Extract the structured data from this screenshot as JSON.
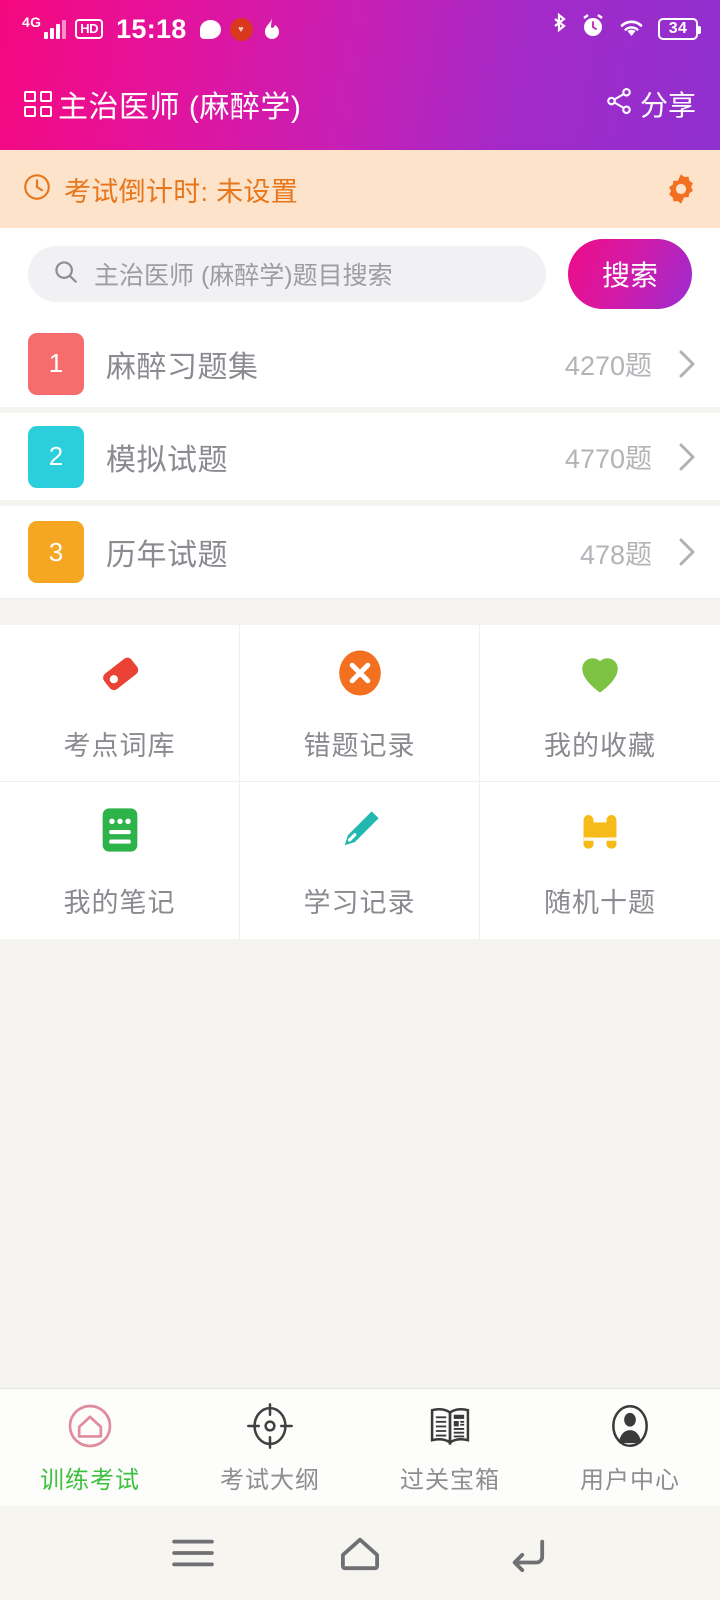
{
  "status_bar": {
    "network_type": "4G",
    "hd_label": "HD",
    "time": "15:18",
    "battery_level": "34",
    "icons": [
      "signal-bars-icon",
      "hd-icon",
      "chat-bubble-icon",
      "red-heart-badge-icon",
      "flame-icon",
      "bluetooth-icon",
      "alarm-icon",
      "wifi-icon",
      "battery-icon"
    ]
  },
  "header": {
    "title": "主治医师 (麻醉学)",
    "grid_icon": "apps-grid-icon",
    "share_label": "分享",
    "share_icon": "share-icon",
    "gradient_from": "#f5087f",
    "gradient_to": "#8f30cf"
  },
  "countdown": {
    "clock_icon": "clock-icon",
    "text": "考试倒计时: 未设置",
    "gear_icon": "gear-icon",
    "background": "#fde3ca",
    "text_color": "#e8761b"
  },
  "search": {
    "placeholder": "主治医师 (麻醉学)题目搜索",
    "value": "",
    "search_icon": "search-icon",
    "button_label": "搜索"
  },
  "question_banks": [
    {
      "index": "1",
      "label": "麻醉习题集",
      "count": "4270题",
      "color": "#f76d6d"
    },
    {
      "index": "2",
      "label": "模拟试题",
      "count": "4770题",
      "color": "#2bcfdb"
    },
    {
      "index": "3",
      "label": "历年试题",
      "count": "478题",
      "color": "#f5a623"
    }
  ],
  "tools": [
    {
      "label": "考点词库",
      "icon": "price-tag-icon",
      "color": "#ea4335"
    },
    {
      "label": "错题记录",
      "icon": "x-circle-icon",
      "color": "#f37021"
    },
    {
      "label": "我的收藏",
      "icon": "heart-icon",
      "color": "#7cc243"
    },
    {
      "label": "我的笔记",
      "icon": "note-icon",
      "color": "#2eb34a"
    },
    {
      "label": "学习记录",
      "icon": "pencil-icon",
      "color": "#20b8b0"
    },
    {
      "label": "随机十题",
      "icon": "binoculars-icon",
      "color": "#f5bc19"
    }
  ],
  "tab_bar": [
    {
      "label": "训练考试",
      "icon": "home-circle-icon",
      "active": true
    },
    {
      "label": "考试大纲",
      "icon": "target-icon",
      "active": false
    },
    {
      "label": "过关宝箱",
      "icon": "open-book-icon",
      "active": false
    },
    {
      "label": "用户中心",
      "icon": "person-icon",
      "active": false
    }
  ],
  "android_nav": [
    {
      "icon": "menu-icon"
    },
    {
      "icon": "home-icon"
    },
    {
      "icon": "back-icon"
    }
  ]
}
